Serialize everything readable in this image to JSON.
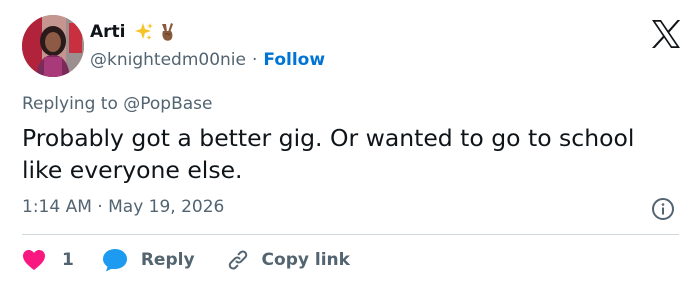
{
  "author": {
    "display_name": "Arti",
    "emojis": [
      "sparkles-icon",
      "victory-hand-icon"
    ],
    "handle": "@knightedm00nie",
    "separator": "·",
    "follow_label": "Follow"
  },
  "reply_context": {
    "prefix": "Replying to ",
    "mention": "@PopBase"
  },
  "tweet": {
    "text": "Probably got a better gig. Or wanted to go to school like everyone else.",
    "time": "1:14 AM",
    "separator": "·",
    "date": "May 19, 2026"
  },
  "actions": {
    "like_count": "1",
    "reply_label": "Reply",
    "copy_label": "Copy link"
  },
  "colors": {
    "link": "#0074d4",
    "muted": "#536471",
    "like": "#f91880",
    "reply": "#1d9bf0",
    "text": "#0f1419",
    "divider": "#cfd9de"
  }
}
